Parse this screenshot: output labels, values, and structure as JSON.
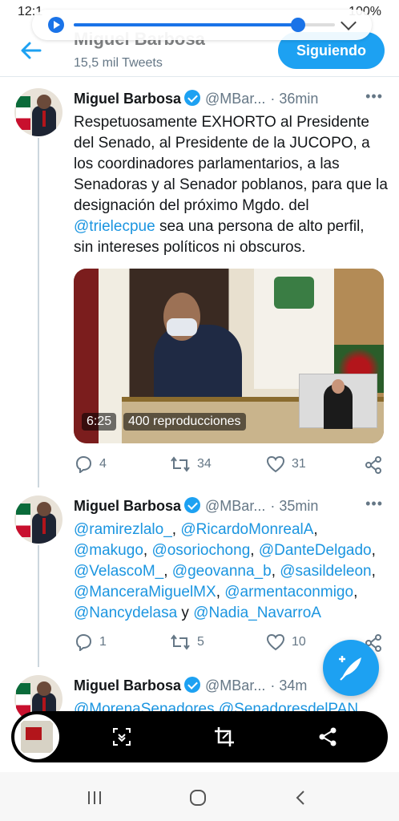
{
  "status": {
    "time": "12:1",
    "battery": "100%"
  },
  "media": {
    "progress": 0.86
  },
  "header": {
    "name": "Miguel Barbosa",
    "tweet_count": "15,5 mil Tweets",
    "follow_label": "Siguiendo"
  },
  "tweets": [
    {
      "name": "Miguel Barbosa",
      "handle": "@MBar...",
      "time": "· 36min",
      "text_before": "Respetuosamente EXHORTO al Presidente del Senado, al Presidente de la JUCOPO, a los coordinadores parlamentarios, a las Senadoras y al Senador poblanos, para que la designación del próximo Mgdo. del ",
      "link": "@trielecpue",
      "text_after": " sea una persona de alto perfil, sin intereses políticos ni obscuros.",
      "video": {
        "duration": "6:25",
        "views": "400 reproducciones"
      },
      "replies": "4",
      "retweets": "34",
      "likes": "31"
    },
    {
      "name": "Miguel Barbosa",
      "handle": "@MBar...",
      "time": "· 35min",
      "mentions": [
        "@ramirezlalo_",
        "@RicardoMonrealA",
        "@makugo",
        "@osoriochong",
        "@DanteDelgado",
        "@VelascoM_",
        "@geovanna_b",
        "@sasildeleon",
        "@ManceraMiguelMX",
        "@armentaconmigo",
        "@Nancydelasa"
      ],
      "conj": " y ",
      "last_mention": "@Nadia_NavarroA",
      "replies": "1",
      "retweets": "5",
      "likes": "10"
    },
    {
      "name": "Miguel Barbosa",
      "handle": "@MBar...",
      "time": "· 34m",
      "partial_line": "@MorenaSenadores @SenadoresdelPAN"
    }
  ],
  "more_label": "•••",
  "colors": {
    "accent": "#1da1f2",
    "link": "#1b95e0",
    "muted": "#657786"
  }
}
